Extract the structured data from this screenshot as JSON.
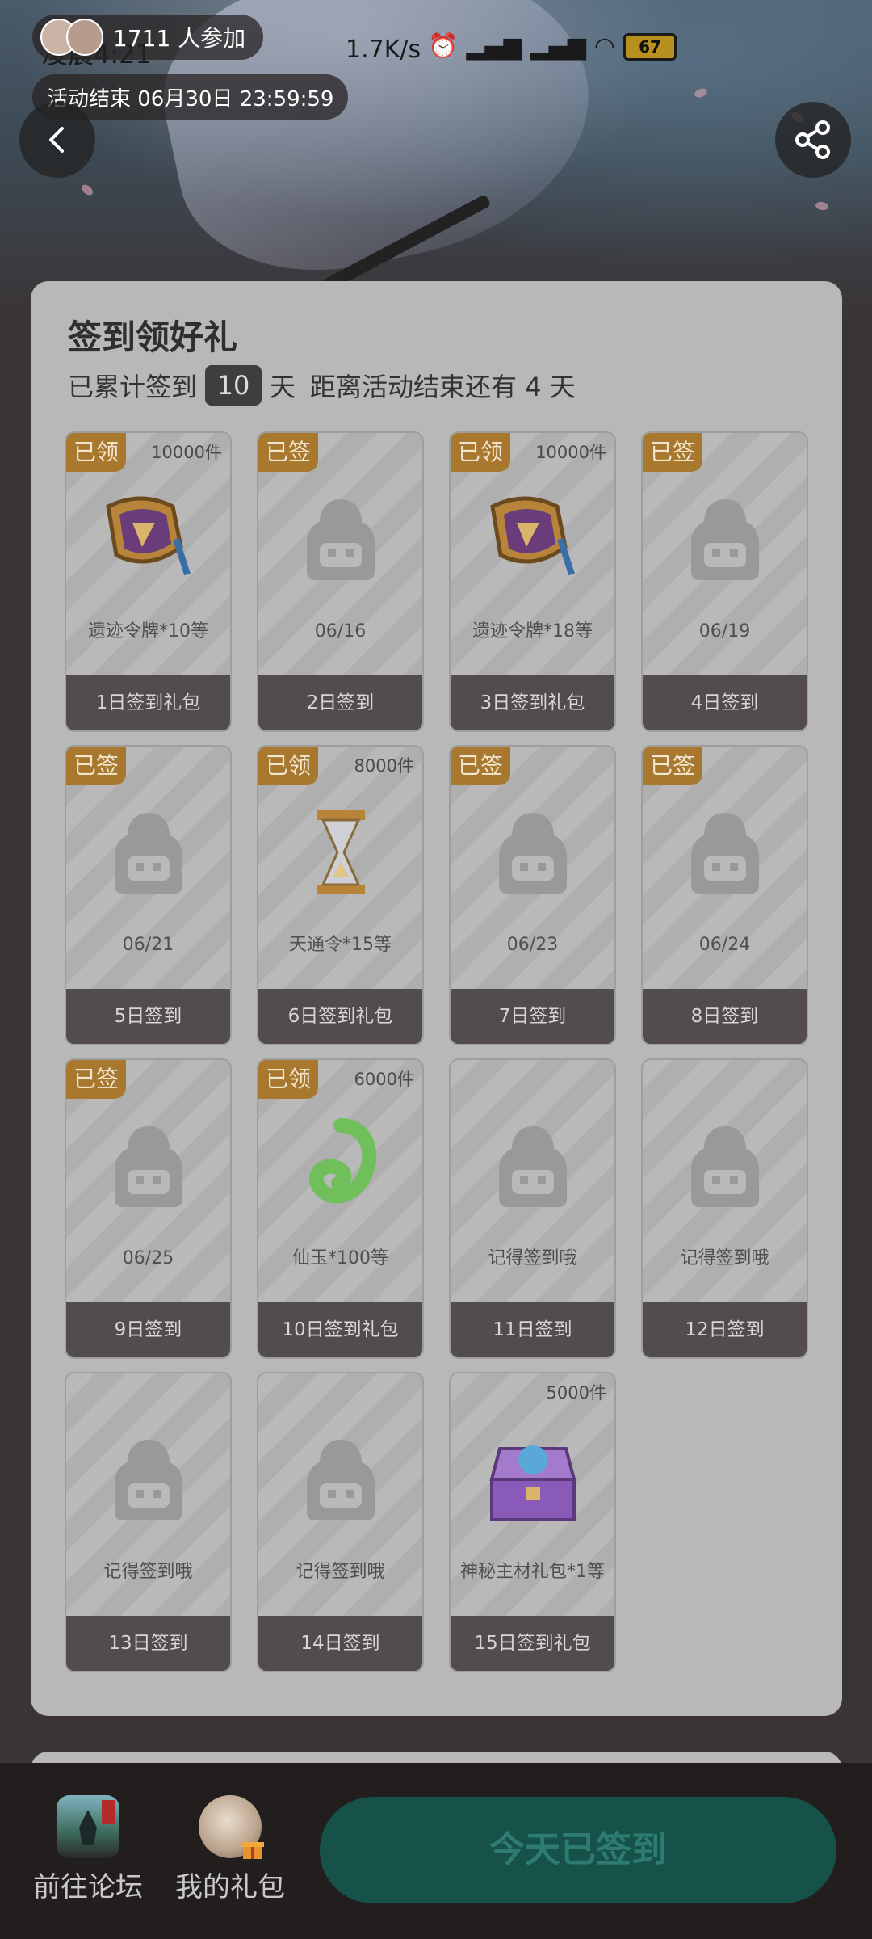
{
  "status_bar": {
    "time": "凌晨4:21",
    "speed": "1.7K/s",
    "battery": "67"
  },
  "header": {
    "participants": "1711 人参加",
    "end_time": "活动结束 06月30日 23:59:59"
  },
  "card": {
    "title": "签到领好礼",
    "sub_prefix": "已累计签到",
    "days_count": "10",
    "sub_unit": "天",
    "remaining": "距离活动结束还有 4 天"
  },
  "tiles": [
    {
      "badge": "已领",
      "qty": "10000件",
      "icon": "token-icon",
      "text": "遗迹令牌*10等",
      "footer": "1日签到礼包"
    },
    {
      "badge": "已签",
      "qty": "",
      "icon": "placeholder-icon",
      "text": "06/16",
      "footer": "2日签到"
    },
    {
      "badge": "已领",
      "qty": "10000件",
      "icon": "token-icon",
      "text": "遗迹令牌*18等",
      "footer": "3日签到礼包"
    },
    {
      "badge": "已签",
      "qty": "",
      "icon": "placeholder-icon",
      "text": "06/19",
      "footer": "4日签到"
    },
    {
      "badge": "已签",
      "qty": "",
      "icon": "placeholder-icon",
      "text": "06/21",
      "footer": "5日签到"
    },
    {
      "badge": "已领",
      "qty": "8000件",
      "icon": "hourglass-icon",
      "text": "天通令*15等",
      "footer": "6日签到礼包"
    },
    {
      "badge": "已签",
      "qty": "",
      "icon": "placeholder-icon",
      "text": "06/23",
      "footer": "7日签到"
    },
    {
      "badge": "已签",
      "qty": "",
      "icon": "placeholder-icon",
      "text": "06/24",
      "footer": "8日签到"
    },
    {
      "badge": "已签",
      "qty": "",
      "icon": "placeholder-icon",
      "text": "06/25",
      "footer": "9日签到"
    },
    {
      "badge": "已领",
      "qty": "6000件",
      "icon": "jade-icon",
      "text": "仙玉*100等",
      "footer": "10日签到礼包"
    },
    {
      "badge": "",
      "qty": "",
      "icon": "placeholder-icon",
      "text": "记得签到哦",
      "footer": "11日签到"
    },
    {
      "badge": "",
      "qty": "",
      "icon": "placeholder-icon",
      "text": "记得签到哦",
      "footer": "12日签到"
    },
    {
      "badge": "",
      "qty": "",
      "icon": "placeholder-icon",
      "text": "记得签到哦",
      "footer": "13日签到"
    },
    {
      "badge": "",
      "qty": "",
      "icon": "placeholder-icon",
      "text": "记得签到哦",
      "footer": "14日签到"
    },
    {
      "badge": "",
      "qty": "5000件",
      "icon": "chest-icon",
      "text": "神秘主材礼包*1等",
      "footer": "15日签到礼包"
    }
  ],
  "bottom_bar": {
    "forum_label": "前往论坛",
    "gifts_label": "我的礼包",
    "checkin_label": "今天已签到"
  },
  "colors": {
    "badge": "#a8782e",
    "footer": "#524c4c",
    "checkin_button": "#17524a"
  }
}
